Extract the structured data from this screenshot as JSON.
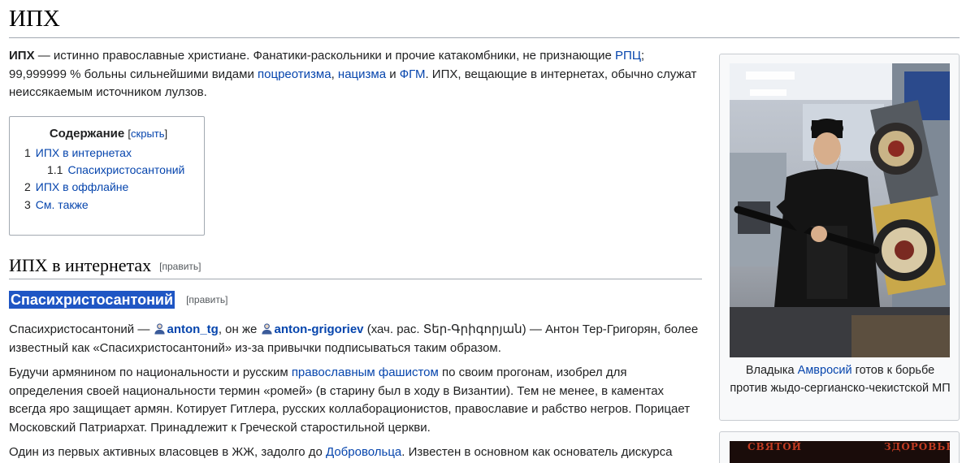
{
  "page": {
    "title": "ИПХ"
  },
  "intro": {
    "lead_bold": "ИПХ",
    "t1": " — истинно православные христиане. Фанатики-раскольники и прочие катакомбники, не признающие ",
    "link_rpc": "РПЦ",
    "t2": "; 99,999999 % больны сильнейшими видами ",
    "link_potsreotizm": "поцреотизма",
    "t3": ", ",
    "link_natsizm": "нацизма",
    "t4": " и ",
    "link_fgm": "ФГМ",
    "t5": ". ИПХ, вещающие в интернетах, обычно служат неиссякаемым источником лулзов."
  },
  "toc": {
    "title": "Содержание",
    "toggle_open": "[",
    "toggle_label": "скрыть",
    "toggle_close": "]",
    "items": [
      {
        "num": "1",
        "label": "ИПХ в интернетах"
      },
      {
        "num": "1.1",
        "label": "Спасихристосантоний"
      },
      {
        "num": "2",
        "label": "ИПХ в оффлайне"
      },
      {
        "num": "3",
        "label": "См. также"
      }
    ]
  },
  "section1": {
    "heading": "ИПХ в интернетах",
    "edit": "[править]"
  },
  "section1_1": {
    "heading": "Спасихристосантоний",
    "edit": "[править]"
  },
  "para1": {
    "t1": "Спасихристосантоний — ",
    "user1": "anton_tg",
    "t2": ", он же ",
    "user2": "anton-grigoriev",
    "t3": " (хач. рас. Տեր-Գրիգորյան) — Антон Тер-Григорян, более известный как «Спасихристосантоний» из-за привычки подписываться таким образом."
  },
  "para2": {
    "t1": "Будучи армянином по национальности и русским ",
    "link1": "православным фашистом",
    "t2": " по своим прогонам, изобрел для определения своей национальности термин «ромей» (в старину был в ходу в Византии). Тем не менее, в каментах всегда яро защищает армян. Котирует Гитлера, русских коллаборационистов, православие и рабство негров. Порицает Московский Патриархат. Принадлежит к Греческой старостильной церкви."
  },
  "para3": {
    "t1": "Один из первых активных власовцев в ЖЖ, задолго до ",
    "link1": "Добровольца",
    "t2": ". Известен в основном как основатель дискурса"
  },
  "thumb": {
    "caption_t1": "Владыка ",
    "caption_link": "Амвросий",
    "caption_t2": " готов к борьбе против жыдо-сергианско-чекистской МП"
  },
  "thumb2": {
    "label_left": "СВЯТОЙ",
    "label_right": "ЗДОРОВЬЕ"
  },
  "colors": {
    "link": "#0645ad",
    "highlight": "#1f56c4",
    "border": "#a2a9b1"
  }
}
